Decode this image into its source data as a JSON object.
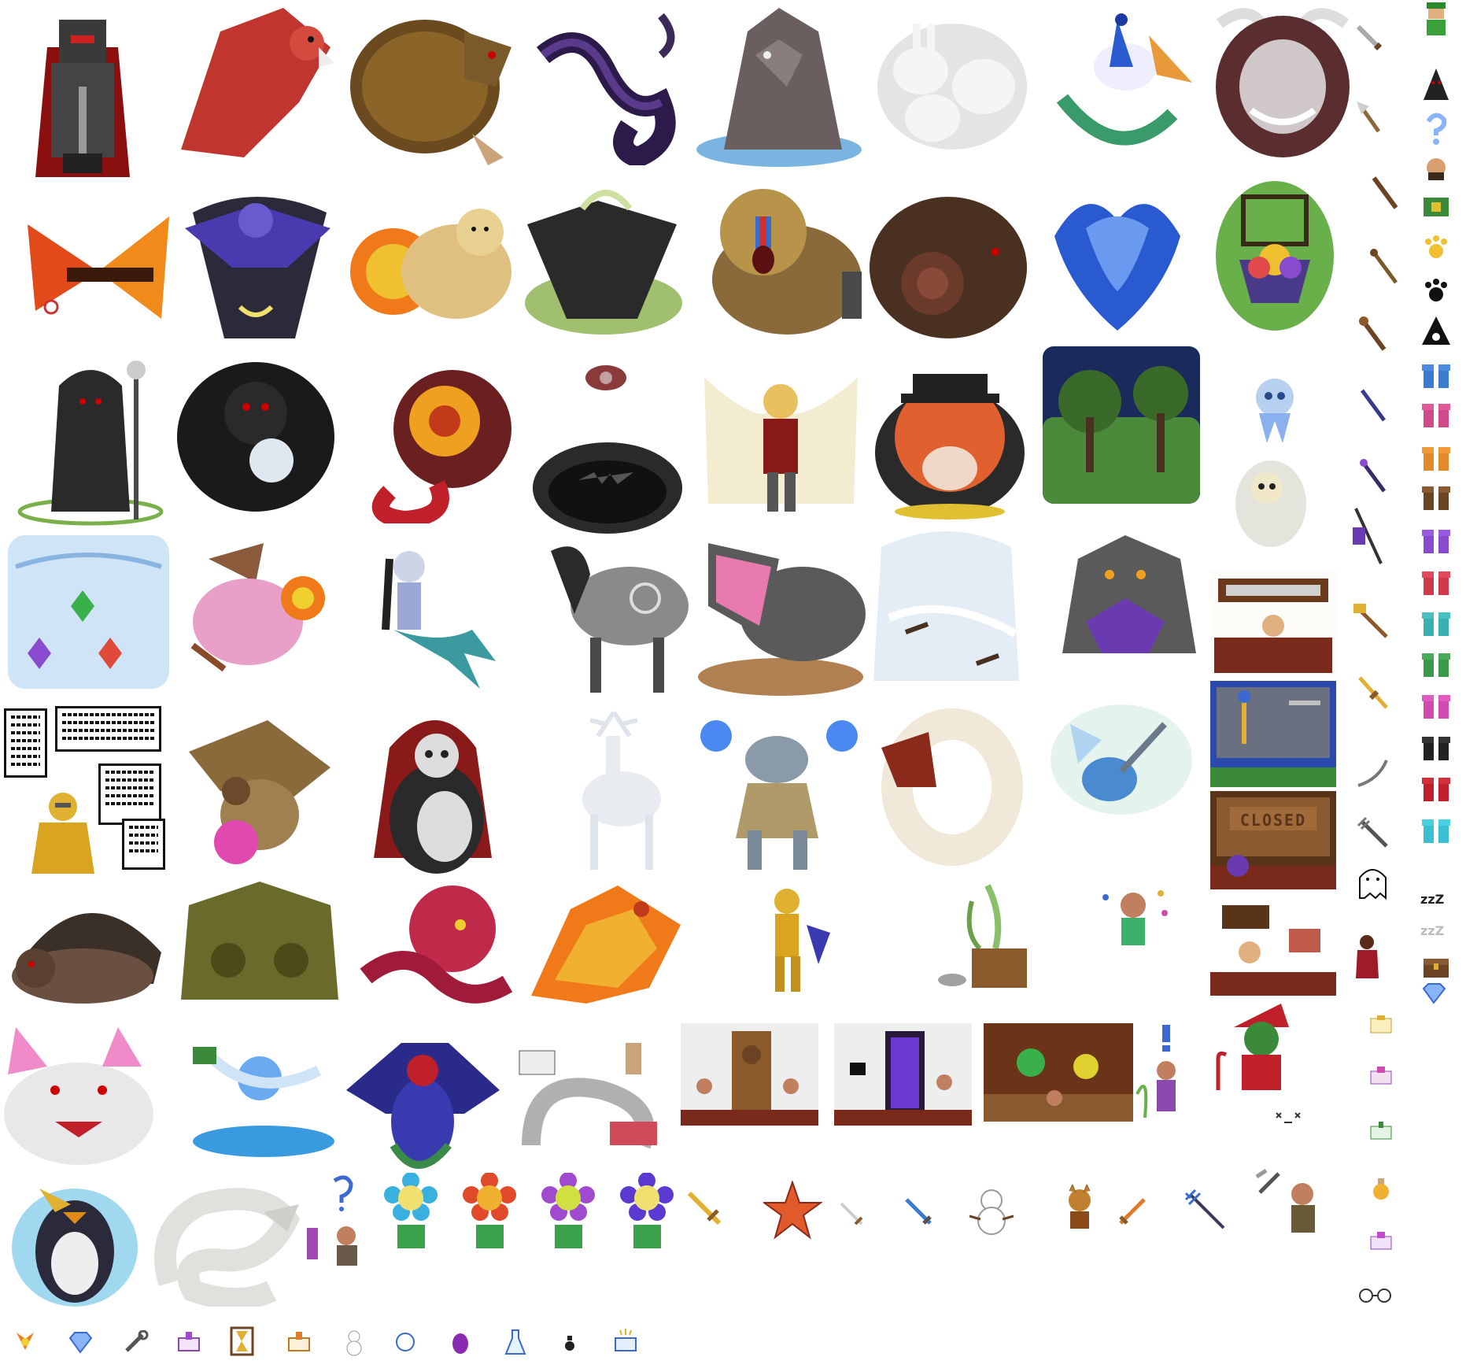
{
  "sheet": {
    "closed_sign": "CLOSED",
    "sleep_text": "zzZ",
    "sleep_text_dim": "zzZ"
  },
  "palette": {
    "background": "#ffffff",
    "outline": "#1a1a1a",
    "red": "#b8312f",
    "gold": "#d9a521",
    "blue": "#3b6fd0",
    "green": "#3a9a3a",
    "purple": "#7a3fb0",
    "brown": "#6b4423",
    "gray": "#7a7a7a"
  }
}
